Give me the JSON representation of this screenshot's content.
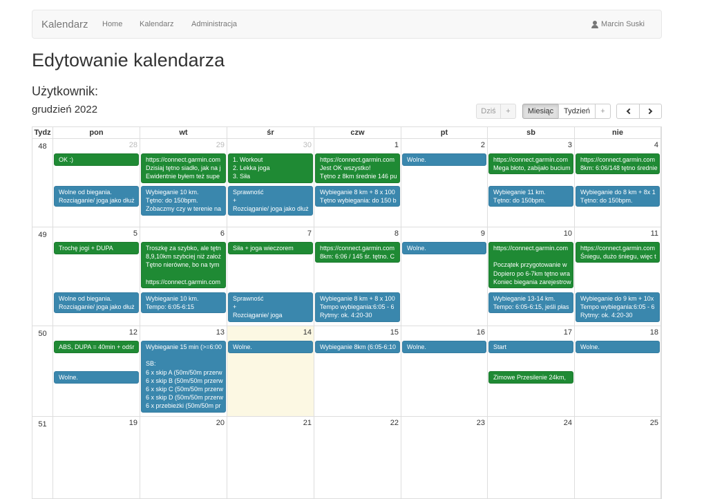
{
  "navbar": {
    "brand": "Kalendarz",
    "links": [
      "Home",
      "Kalendarz",
      "Administracja"
    ],
    "user": "Marcin Suski"
  },
  "page": {
    "title": "Edytowanie kalendarza",
    "subtitle": "Użytkownik:",
    "month": "grudzień 2022"
  },
  "toolbar": {
    "today": "Dziś",
    "today_add": "+",
    "month": "Miesiąc",
    "week": "Tydzień",
    "week_add": "+"
  },
  "calendar": {
    "week_header": "Tydz",
    "days": [
      "pon",
      "wt",
      "śr",
      "czw",
      "pt",
      "sb",
      "nie"
    ],
    "weeks": [
      {
        "number": "48",
        "days": [
          {
            "date": "28",
            "other": true,
            "events": [
              {
                "color": "green",
                "lines": [
                  "OK :)"
                ]
              },
              {
                "color": "blue",
                "lines": [
                  "Wolne od biegania.",
                  "Rozciąganie/ joga jako dłuż"
                ]
              }
            ]
          },
          {
            "date": "29",
            "other": true,
            "events": [
              {
                "color": "green",
                "lines": [
                  "https://connect.garmin.com",
                  "Dzisiaj tętno siadło, jak na j",
                  "Ewidentnie byłem też supe"
                ]
              },
              {
                "color": "blue",
                "lines": [
                  "Wybieganie 10 km.",
                  "Tętno: do 150bpm.",
                  "Zobaczmy czy w terenie na"
                ]
              }
            ]
          },
          {
            "date": "30",
            "other": true,
            "events": [
              {
                "color": "green",
                "lines": [
                  "1. Workout",
                  "2. Lekka joga",
                  "3. Siła"
                ]
              },
              {
                "color": "blue",
                "lines": [
                  "Sprawność",
                  "+",
                  "Rozciąganie/ joga jako dłuż"
                ]
              }
            ]
          },
          {
            "date": "1",
            "events": [
              {
                "color": "green",
                "lines": [
                  "https://connect.garmin.com",
                  "Jest OK wszystko!",
                  "Tętno z 8km średnie 146 pu"
                ]
              },
              {
                "color": "blue",
                "lines": [
                  "Wybieganie 8 km + 8 x 100",
                  "Tętno wybiegania: do 150 b"
                ]
              }
            ]
          },
          {
            "date": "2",
            "events": [
              {
                "color": "blue",
                "lines": [
                  "Wolne."
                ]
              }
            ]
          },
          {
            "date": "3",
            "events": [
              {
                "color": "green",
                "lines": [
                  "https://connect.garmin.com",
                  "Mega błoto, zabijało bucium"
                ]
              },
              {
                "color": "blue",
                "lines": [
                  "Wybieganie 11 km.",
                  "Tętno: do 150bpm."
                ]
              }
            ]
          },
          {
            "date": "4",
            "events": [
              {
                "color": "green",
                "lines": [
                  "https://connect.garmin.com",
                  "8km: 6:06/148 tętno średnie"
                ]
              },
              {
                "color": "blue",
                "lines": [
                  "Wybieganie do 8 km + 8x 1",
                  "Tętno: do 150bpm."
                ]
              }
            ]
          }
        ]
      },
      {
        "number": "49",
        "days": [
          {
            "date": "5",
            "events": [
              {
                "color": "green",
                "lines": [
                  "Trochę jogi + DUPA"
                ]
              },
              {
                "color": "blue",
                "lines": [
                  "Wolne od biegania.",
                  "Rozciąganie/ joga jako dłuż"
                ]
              }
            ]
          },
          {
            "date": "6",
            "events": [
              {
                "color": "green",
                "lines": [
                  "Troszkę za szybko, ale tętn",
                  "8,9,10km szybciej niż założ",
                  "Tętno nierówne, bo na tym",
                  "",
                  "https://connect.garmin.com"
                ]
              },
              {
                "color": "blue",
                "lines": [
                  "Wybieganie 10 km.",
                  "Tempo: 6:05-6:15"
                ]
              }
            ]
          },
          {
            "date": "7",
            "events": [
              {
                "color": "green",
                "lines": [
                  "Siła + joga wieczorem"
                ]
              },
              {
                "color": "blue",
                "lines": [
                  "Sprawność",
                  "+",
                  "Rozciąganie/ joga"
                ]
              }
            ]
          },
          {
            "date": "8",
            "events": [
              {
                "color": "green",
                "lines": [
                  "https://connect.garmin.com",
                  "8km: 6:06 / 145 śr. tętno. C"
                ]
              },
              {
                "color": "blue",
                "lines": [
                  "Wybieganie 8 km + 8 x 100",
                  "Tempo wybiegania:6:05 - 6",
                  "Rytmy: ok. 4:20-30"
                ]
              }
            ]
          },
          {
            "date": "9",
            "events": [
              {
                "color": "blue",
                "lines": [
                  "Wolne."
                ]
              }
            ]
          },
          {
            "date": "10",
            "events": [
              {
                "color": "green",
                "lines": [
                  "https://connect.garmin.com",
                  "",
                  "Początek przygotowanie w",
                  "Dopiero po 6-7km tętno wra",
                  "Koniec biegania zarejestrow"
                ]
              },
              {
                "color": "blue",
                "lines": [
                  "Wybieganie 13-14 km.",
                  "Tempo: 6:05-6:15, jeśli płas"
                ]
              }
            ]
          },
          {
            "date": "11",
            "events": [
              {
                "color": "green",
                "lines": [
                  "https://connect.garmin.com",
                  "Śniegu, dużo śniegu, więc t"
                ]
              },
              {
                "color": "blue",
                "lines": [
                  "Wybieganie do 9 km + 10x",
                  "Tempo wybiegania:6:05 - 6",
                  "Rytmy: ok. 4:20-30"
                ]
              }
            ]
          }
        ]
      },
      {
        "number": "50",
        "days": [
          {
            "date": "12",
            "events": [
              {
                "color": "green",
                "lines": [
                  "ABS, DUPA = 40min + odśr"
                ]
              },
              {
                "color": "blue",
                "lines": [
                  "Wolne."
                ]
              }
            ]
          },
          {
            "date": "13",
            "events": [
              {
                "color": "blue",
                "lines": [
                  "Wybieganie 15 min (>=6:00",
                  "",
                  "SB:",
                  "6 x skip A (50m/50m przerw",
                  "6 x skip B (50m/50m przerw",
                  "6 x skip C (50m/50m przerw",
                  "6 x skip D (50m/50m przerw",
                  "6 x przebieżki (50m/50m pr"
                ]
              }
            ]
          },
          {
            "date": "14",
            "today": true,
            "events": [
              {
                "color": "blue",
                "lines": [
                  "Wolne."
                ]
              }
            ]
          },
          {
            "date": "15",
            "events": [
              {
                "color": "blue",
                "lines": [
                  "Wybieganie 8km (6:05-6:10"
                ]
              }
            ]
          },
          {
            "date": "16",
            "events": [
              {
                "color": "blue",
                "lines": [
                  "Wolne."
                ]
              }
            ]
          },
          {
            "date": "17",
            "events": [
              {
                "color": "blue",
                "lines": [
                  "Start"
                ]
              },
              {
                "color": "green",
                "lines": [
                  "Zimowe Przesilenie 24km,"
                ]
              }
            ]
          },
          {
            "date": "18",
            "events": [
              {
                "color": "blue",
                "lines": [
                  "Wolne."
                ]
              }
            ]
          }
        ]
      },
      {
        "number": "51",
        "days": [
          {
            "date": "19",
            "events": []
          },
          {
            "date": "20",
            "events": []
          },
          {
            "date": "21",
            "events": []
          },
          {
            "date": "22",
            "events": []
          },
          {
            "date": "23",
            "events": []
          },
          {
            "date": "24",
            "events": []
          },
          {
            "date": "25",
            "events": []
          }
        ]
      }
    ]
  }
}
